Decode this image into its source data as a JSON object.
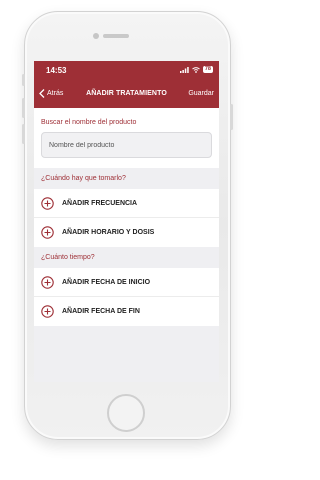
{
  "status_bar": {
    "time": "14:53",
    "battery": "78"
  },
  "nav": {
    "back_label": "Atrás",
    "title": "AÑADIR TRATAMIENTO",
    "save_label": "Guardar"
  },
  "search": {
    "label": "Buscar el nombre del producto",
    "placeholder": "Nombre del producto"
  },
  "sections": [
    {
      "header": "¿Cuándo hay que tomarlo?",
      "items": [
        {
          "label": "AÑADIR FRECUENCIA"
        },
        {
          "label": "AÑADIR HORARIO Y DOSIS"
        }
      ]
    },
    {
      "header": "¿Cuánto tiempo?",
      "items": [
        {
          "label": "AÑADIR FECHA DE INICIO"
        },
        {
          "label": "AÑADIR FECHA DE FIN"
        }
      ]
    }
  ],
  "colors": {
    "accent": "#9e2f36",
    "background": "#efeff2"
  },
  "icons": {
    "back": "chevron-left-icon",
    "add": "plus-circle-icon",
    "wifi": "wifi-icon",
    "signal": "signal-icon",
    "battery": "battery-icon"
  }
}
